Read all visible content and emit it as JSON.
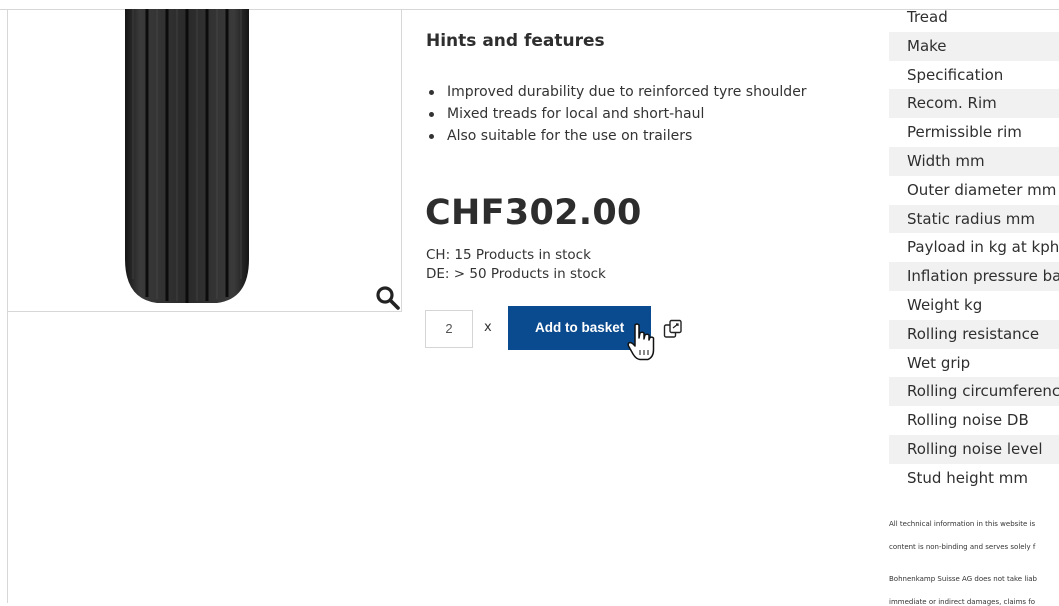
{
  "product": {
    "hints_title": "Hints and features",
    "features": [
      "Improved durability due to reinforced tyre shoulder",
      "Mixed treads for local and short-haul",
      "Also suitable for the use on trailers"
    ],
    "price": "CHF302.00",
    "stock_ch": "CH: 15 Products in stock",
    "stock_de": "DE: > 50 Products in stock",
    "quantity": "2",
    "times": "x",
    "add_to_basket": "Add to basket"
  },
  "specs": [
    "Tread",
    "Make",
    "Specification",
    "Recom. Rim",
    "Permissible rim",
    "Width mm",
    "Outer diameter mm",
    "Static radius mm",
    "Payload in kg at kph (",
    "Inflation pressure bar",
    "Weight kg",
    "Rolling resistance",
    "Wet grip",
    "Rolling circumference",
    "Rolling noise DB",
    "Rolling noise level",
    "Stud height mm"
  ],
  "disclaimer": [
    "All technical information in this website is",
    "content is non-binding and serves solely f",
    "Bohnenkamp Suisse AG does not take liab",
    "immediate or indirect damages, claims fo"
  ],
  "colors": {
    "accent": "#0a4a8e",
    "stripe": "#f1f1f1",
    "border": "#d7d7d7"
  },
  "icons": {
    "zoom": "magnifier-icon",
    "compare": "compare-icon",
    "cursor": "hand-pointer-icon"
  }
}
